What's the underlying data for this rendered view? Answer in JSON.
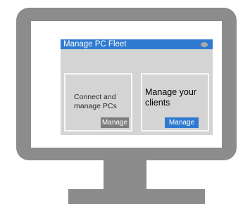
{
  "window": {
    "title": "Manage PC Fleet"
  },
  "cards": [
    {
      "description": "Connect and manage PCs",
      "button_label": "Manage"
    },
    {
      "description": "Manage your clients",
      "button_label": "Manage"
    }
  ],
  "colors": {
    "monitor": "#8c8c8c",
    "title_bar": "#2f7ad1",
    "window_body": "#d4d4d4",
    "primary_button": "#2f7ad1",
    "secondary_button": "#7d7d7d"
  },
  "icons": {
    "window_control": "circle-dot-icon"
  }
}
